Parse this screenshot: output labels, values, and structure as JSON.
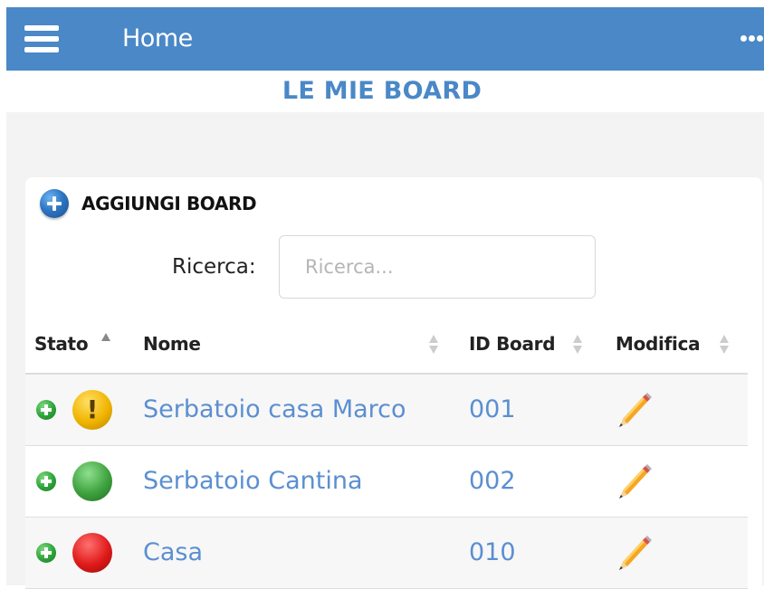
{
  "header": {
    "title": "Home",
    "menu_icon": "hamburger-icon",
    "more_icon": "more-icon"
  },
  "page": {
    "title": "LE MIE BOARD"
  },
  "add_board": {
    "label": "AGGIUNGI BOARD",
    "icon": "plus-circle-icon"
  },
  "search": {
    "label": "Ricerca:",
    "placeholder": "Ricerca...",
    "value": ""
  },
  "table": {
    "columns": [
      "Stato",
      "Nome",
      "ID Board",
      "Modifica"
    ],
    "rows": [
      {
        "status": "warning",
        "status_symbol": "!",
        "name": "Serbatoio casa Marco",
        "id": "001"
      },
      {
        "status": "ok",
        "status_symbol": "",
        "name": "Serbatoio Cantina",
        "id": "002"
      },
      {
        "status": "error",
        "status_symbol": "",
        "name": "Casa",
        "id": "010"
      }
    ]
  },
  "colors": {
    "header_bg": "#4a88c7",
    "link": "#5b8fd1",
    "status_warning": "#f0b400",
    "status_ok": "#3ea13e",
    "status_error": "#e01a1a"
  }
}
